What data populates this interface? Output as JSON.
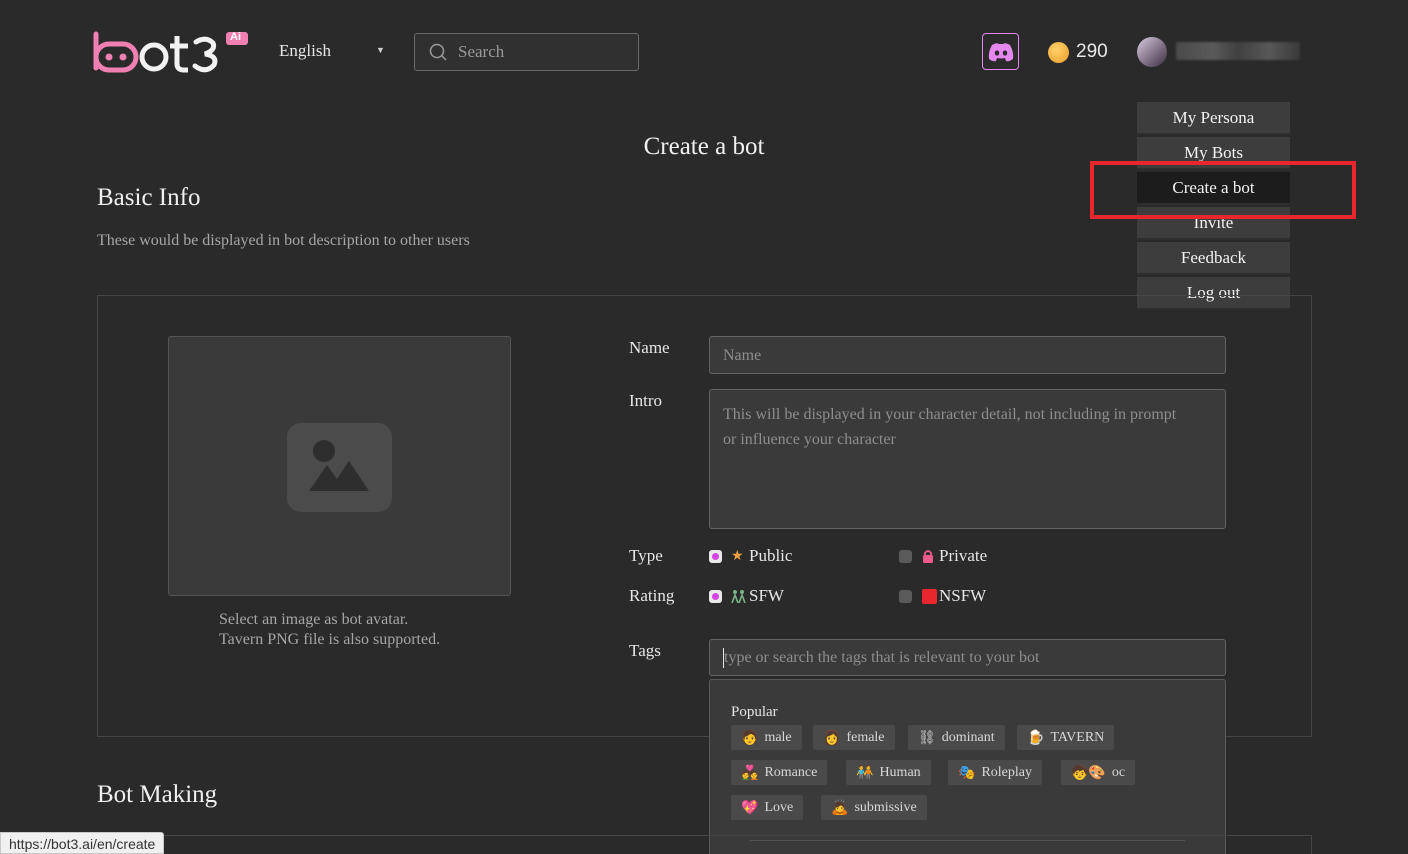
{
  "header": {
    "logo_text": "bot3",
    "logo_badge": "Ai",
    "language": "English",
    "search_placeholder": "Search",
    "coins": "290",
    "colors": {
      "brand_pink": "#f07fb2",
      "discord_purple": "#e487ee"
    }
  },
  "menu": {
    "items": [
      "My Persona",
      "My Bots",
      "Create a bot",
      "Invite",
      "Feedback",
      "Log out"
    ],
    "active": "Create a bot"
  },
  "page": {
    "title": "Create a bot",
    "basic_info_title": "Basic Info",
    "basic_info_desc": "These would be displayed in bot description to other users",
    "bot_making_title": "Bot Making"
  },
  "avatar": {
    "hint_line1": "Select an image as bot avatar.",
    "hint_line2": "Tavern PNG file is also supported."
  },
  "form": {
    "name_label": "Name",
    "name_placeholder": "Name",
    "intro_label": "Intro",
    "intro_placeholder": "This will be displayed in your character detail, not including in prompt or influence your character",
    "type_label": "Type",
    "type_public": "Public",
    "type_private": "Private",
    "type_selected": "Public",
    "rating_label": "Rating",
    "rating_sfw": "SFW",
    "rating_nsfw": "NSFW",
    "rating_selected": "SFW",
    "tags_label": "Tags",
    "tags_placeholder": "type or search the tags that is relevant to your bot"
  },
  "tags": {
    "popular_label": "Popular",
    "items": [
      {
        "emoji": "🧑",
        "label": "male"
      },
      {
        "emoji": "👩",
        "label": "female"
      },
      {
        "emoji": "⛓",
        "label": "dominant"
      },
      {
        "emoji": "🍺",
        "label": "TAVERN"
      },
      {
        "emoji": "💑",
        "label": "Romance"
      },
      {
        "emoji": "🧑‍🤝‍🧑",
        "label": "Human"
      },
      {
        "emoji": "🎭",
        "label": "Roleplay"
      },
      {
        "emoji": "🧒🎨",
        "label": "oc"
      },
      {
        "emoji": "💖",
        "label": "Love"
      },
      {
        "emoji": "🙇",
        "label": "submissive"
      }
    ]
  },
  "status_bar": {
    "url": "https://bot3.ai/en/create"
  }
}
